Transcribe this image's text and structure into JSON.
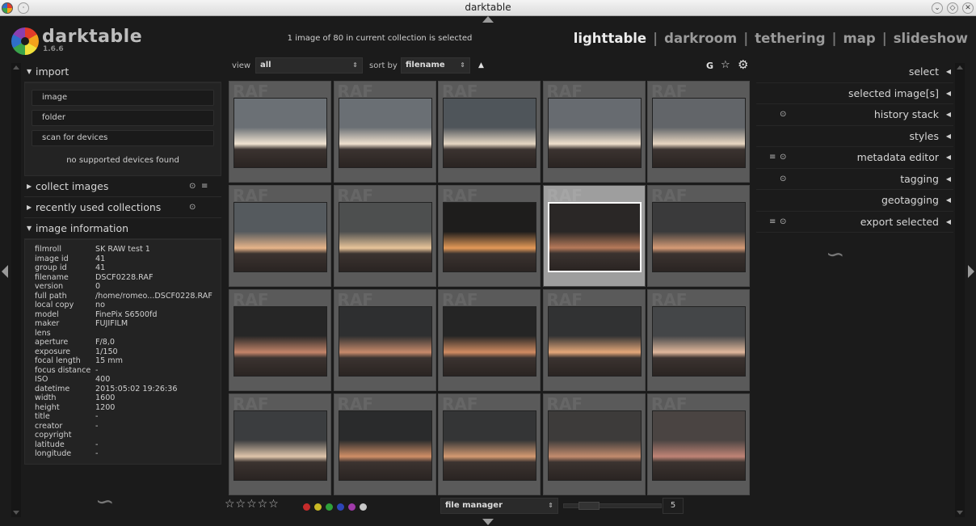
{
  "window": {
    "title": "darktable"
  },
  "app": {
    "name": "darktable",
    "version": "1.6.6"
  },
  "status": "1 image of 80 in current collection is selected",
  "views": [
    {
      "label": "lighttable",
      "active": true
    },
    {
      "label": "darkroom",
      "active": false
    },
    {
      "label": "tethering",
      "active": false
    },
    {
      "label": "map",
      "active": false
    },
    {
      "label": "slideshow",
      "active": false
    }
  ],
  "left": {
    "import": {
      "title": "import",
      "buttons": [
        "image",
        "folder",
        "scan for devices"
      ],
      "no_devices": "no supported devices found"
    },
    "collect": {
      "title": "collect images"
    },
    "recent": {
      "title": "recently used collections"
    },
    "info": {
      "title": "image information",
      "rows": [
        {
          "k": "filmroll",
          "v": "SK RAW test 1"
        },
        {
          "k": "image id",
          "v": "41"
        },
        {
          "k": "group id",
          "v": "41"
        },
        {
          "k": "filename",
          "v": "DSCF0228.RAF"
        },
        {
          "k": "version",
          "v": "0"
        },
        {
          "k": "full path",
          "v": "/home/romeo...DSCF0228.RAF"
        },
        {
          "k": "local copy",
          "v": "no"
        },
        {
          "k": "model",
          "v": "FinePix S6500fd"
        },
        {
          "k": "maker",
          "v": "FUJIFILM"
        },
        {
          "k": "lens",
          "v": ""
        },
        {
          "k": "aperture",
          "v": "F/8,0"
        },
        {
          "k": "exposure",
          "v": "1/150"
        },
        {
          "k": "focal length",
          "v": "15 mm"
        },
        {
          "k": "focus distance",
          "v": "-"
        },
        {
          "k": "ISO",
          "v": "400"
        },
        {
          "k": "datetime",
          "v": "2015:05:02 19:26:36"
        },
        {
          "k": "width",
          "v": "1600"
        },
        {
          "k": "height",
          "v": "1200"
        },
        {
          "k": "title",
          "v": "-"
        },
        {
          "k": "creator",
          "v": "-"
        },
        {
          "k": "copyright",
          "v": ""
        },
        {
          "k": "latitude",
          "v": "-"
        },
        {
          "k": "longitude",
          "v": "-"
        }
      ]
    }
  },
  "toolbar": {
    "view_label": "view",
    "view_value": "all",
    "sort_label": "sort by",
    "sort_value": "filename",
    "sort_dir": "▲",
    "grouping": "G",
    "star": "☆",
    "gear": "⚙"
  },
  "grid": {
    "raf_label": "RAF",
    "selected_index": 8,
    "thumbs": [
      {
        "sky": "#6b7075",
        "glow": "#f1e4d2"
      },
      {
        "sky": "#6a6f74",
        "glow": "#f0e1cf"
      },
      {
        "sky": "#4f555a",
        "glow": "#e7d8c4"
      },
      {
        "sky": "#676b70",
        "glow": "#efe0cc"
      },
      {
        "sky": "#626569",
        "glow": "#e9d7c2"
      },
      {
        "sky": "#555a5e",
        "glow": "#e8b58a"
      },
      {
        "sky": "#4d4f4f",
        "glow": "#e9c59a"
      },
      {
        "sky": "#1e1d1c",
        "glow": "#e59a58"
      },
      {
        "sky": "#2a2726",
        "glow": "#b77a5a"
      },
      {
        "sky": "#3a3a3b",
        "glow": "#d69b76"
      },
      {
        "sky": "#262626",
        "glow": "#c4856a"
      },
      {
        "sky": "#2e2f30",
        "glow": "#c88b6c"
      },
      {
        "sky": "#252525",
        "glow": "#d18c62"
      },
      {
        "sky": "#313233",
        "glow": "#e5a87a"
      },
      {
        "sky": "#444648",
        "glow": "#e1b89c"
      },
      {
        "sky": "#3b3d3f",
        "glow": "#e0c6ab"
      },
      {
        "sky": "#2a2b2c",
        "glow": "#d08f67"
      },
      {
        "sky": "#343536",
        "glow": "#d59a72"
      },
      {
        "sky": "#3d3b3a",
        "glow": "#c48c6e"
      },
      {
        "sky": "#4a4442",
        "glow": "#c08476"
      }
    ]
  },
  "right": {
    "modules": [
      {
        "title": "select",
        "icons": []
      },
      {
        "title": "selected image[s]",
        "icons": []
      },
      {
        "title": "history stack",
        "icons": [
          "reset-icon"
        ]
      },
      {
        "title": "styles",
        "icons": []
      },
      {
        "title": "metadata editor",
        "icons": [
          "presets-icon",
          "reset-icon"
        ]
      },
      {
        "title": "tagging",
        "icons": [
          "reset-icon"
        ]
      },
      {
        "title": "geotagging",
        "icons": []
      },
      {
        "title": "export selected",
        "icons": [
          "presets-icon",
          "reset-icon"
        ]
      }
    ]
  },
  "bottom": {
    "stars": "☆☆☆☆☆",
    "color_labels": [
      "#c62b2b",
      "#c9b925",
      "#2fa03a",
      "#2d46b7",
      "#a03aa9",
      "#c8c8c8"
    ],
    "layout": "file manager",
    "zoom": "5"
  }
}
